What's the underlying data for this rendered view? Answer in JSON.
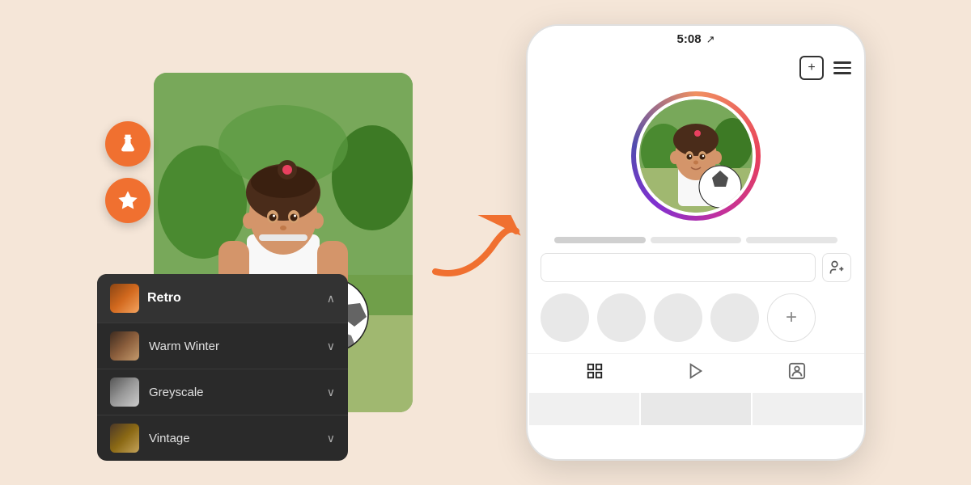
{
  "page": {
    "background_color": "#f5e6d8"
  },
  "left": {
    "float_buttons": [
      {
        "name": "lab-button",
        "icon": "lab",
        "label": "Lab"
      },
      {
        "name": "star-button",
        "icon": "star",
        "label": "Favorites"
      }
    ],
    "dropdown": {
      "header": {
        "label": "Retro",
        "chevron": "∧"
      },
      "items": [
        {
          "label": "Warm Winter",
          "chevron": "∨"
        },
        {
          "label": "Greyscale",
          "chevron": "∨"
        },
        {
          "label": "Vintage",
          "chevron": "∨"
        }
      ]
    }
  },
  "phone": {
    "status_time": "5:08",
    "nav_icon": "↗",
    "bottom_nav": [
      {
        "icon": "⊞",
        "label": "Grid",
        "active": true
      },
      {
        "icon": "▷",
        "label": "Play",
        "active": false
      },
      {
        "icon": "☺",
        "label": "Profile",
        "active": false
      }
    ],
    "add_story_plus": "+",
    "toolbar": {
      "plus_icon": "+",
      "menu_icon": "≡"
    }
  }
}
